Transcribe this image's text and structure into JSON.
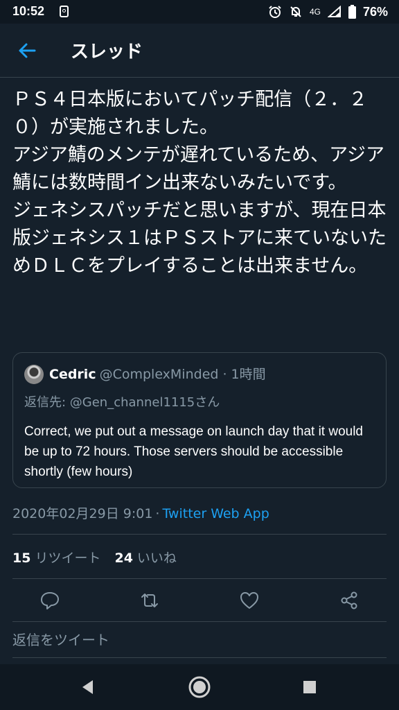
{
  "status_bar": {
    "time": "10:52",
    "network": "4G",
    "battery": "76%",
    "icons": [
      "notification-icon",
      "alarm-icon",
      "mute-icon",
      "signal-icon",
      "battery-icon"
    ]
  },
  "header": {
    "title": "スレッド",
    "back_icon": "arrow-left-icon",
    "accent_color": "#1da1f2"
  },
  "tweet": {
    "text": "ＰＳ４日本版においてパッチ配信（２．２０）が実施されました。\nアジア鯖のメンテが遅れているため、アジア鯖には数時間イン出来ないみたいです。\nジェネシスパッチだと思いますが、現在日本版ジェネシス１はＰＳストアに来ていないためＤＬＣをプレイすることは出来ません。"
  },
  "quote": {
    "name": "Cedric",
    "handle": "@ComplexMinded · 1時間",
    "reply_to": "返信先: @Gen_channel1115さん",
    "body": "Correct, we put out a message on launch day that it would be up to 72 hours.  Those servers should be accessible shortly (few hours)"
  },
  "meta": {
    "date": "2020年02月29日 9:01",
    "separator": "·",
    "source": "Twitter Web App"
  },
  "stats": {
    "retweets_count": "15",
    "retweets_label": "リツイート",
    "likes_count": "24",
    "likes_label": "いいね"
  },
  "actions": [
    "reply-icon",
    "retweet-icon",
    "like-icon",
    "share-icon"
  ],
  "reply": {
    "placeholder": "返信をツイート"
  },
  "nav": [
    "back-triangle-icon",
    "home-circle-icon",
    "recents-square-icon"
  ],
  "colors": {
    "background": "#15202b",
    "text_secondary": "#8899a6",
    "border": "#38444d",
    "link": "#1da1f2"
  }
}
